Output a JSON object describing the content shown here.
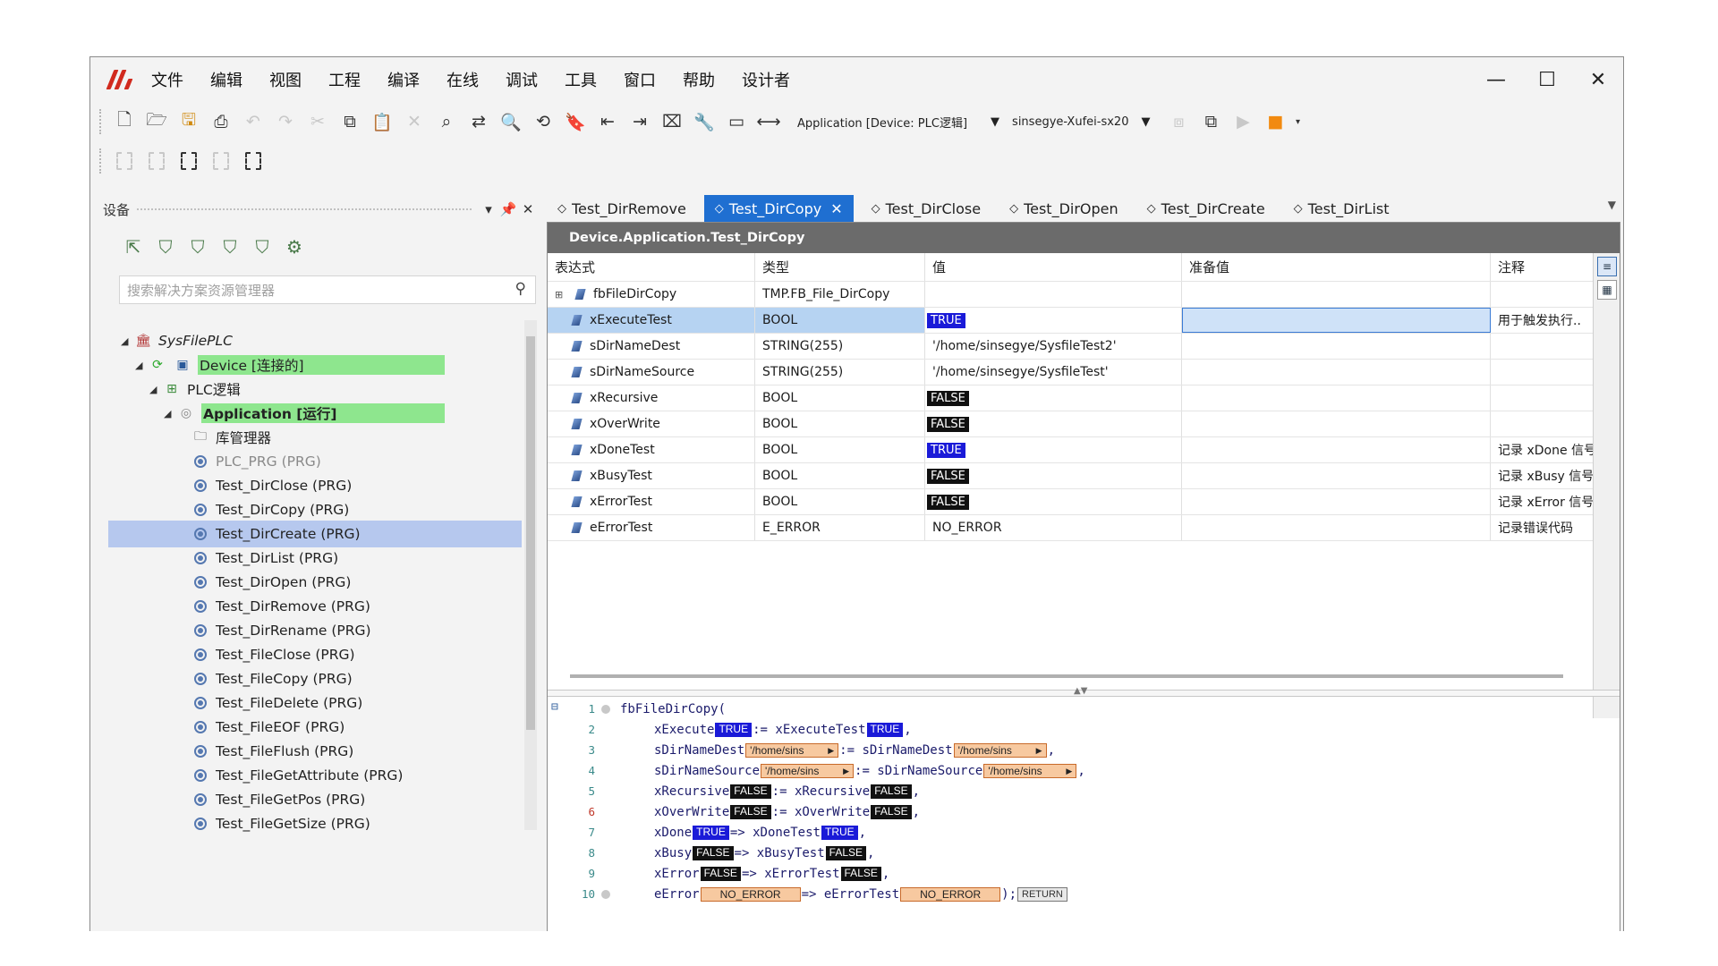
{
  "menu": [
    "文件",
    "编辑",
    "视图",
    "工程",
    "编译",
    "在线",
    "调试",
    "工具",
    "窗口",
    "帮助",
    "设计者"
  ],
  "window_controls": {
    "minimize": "—",
    "maximize": "☐",
    "close": "✕"
  },
  "toolbar": {
    "app_combo": "Application [Device: PLC逻辑]",
    "device_combo": "sinsegye-Xufei-sx20"
  },
  "left_pane": {
    "title": "设备",
    "search_placeholder": "搜索解决方案资源管理器",
    "tree": [
      {
        "label": "SysFilePLC",
        "level": 0
      },
      {
        "label": "Device [连接的]",
        "level": 1
      },
      {
        "label": "PLC逻辑",
        "level": 2
      },
      {
        "label": "Application [运行]",
        "level": 3
      },
      {
        "label": "库管理器",
        "level": 4
      },
      {
        "label": "PLC_PRG (PRG)",
        "level": 4
      },
      {
        "label": "Test_DirClose (PRG)",
        "level": 4
      },
      {
        "label": "Test_DirCopy (PRG)",
        "level": 4
      },
      {
        "label": "Test_DirCreate (PRG)",
        "level": 4
      },
      {
        "label": "Test_DirList (PRG)",
        "level": 4
      },
      {
        "label": "Test_DirOpen (PRG)",
        "level": 4
      },
      {
        "label": "Test_DirRemove (PRG)",
        "level": 4
      },
      {
        "label": "Test_DirRename (PRG)",
        "level": 4
      },
      {
        "label": "Test_FileClose (PRG)",
        "level": 4
      },
      {
        "label": "Test_FileCopy (PRG)",
        "level": 4
      },
      {
        "label": "Test_FileDelete (PRG)",
        "level": 4
      },
      {
        "label": "Test_FileEOF (PRG)",
        "level": 4
      },
      {
        "label": "Test_FileFlush (PRG)",
        "level": 4
      },
      {
        "label": "Test_FileGetAttribute (PRG)",
        "level": 4
      },
      {
        "label": "Test_FileGetPos (PRG)",
        "level": 4
      },
      {
        "label": "Test_FileGetSize (PRG)",
        "level": 4
      }
    ]
  },
  "tabs": [
    "Test_DirRemove",
    "Test_DirCopy",
    "Test_DirClose",
    "Test_DirOpen",
    "Test_DirCreate",
    "Test_DirList"
  ],
  "active_tab": "Test_DirCopy",
  "editor": {
    "title": "Device.Application.Test_DirCopy",
    "columns": {
      "expr": "表达式",
      "type": "类型",
      "value": "值",
      "prepared": "准备值",
      "comment": "注释"
    },
    "rows": [
      {
        "expr": "fbFileDirCopy",
        "type": "TMP.FB_File_DirCopy",
        "value": "",
        "comment": ""
      },
      {
        "expr": "xExecuteTest",
        "type": "BOOL",
        "value": "TRUE",
        "comment": "用于触发执行.."
      },
      {
        "expr": "sDirNameDest",
        "type": "STRING(255)",
        "value": "'/home/sinsegye/SysfileTest2'",
        "comment": ""
      },
      {
        "expr": "sDirNameSource",
        "type": "STRING(255)",
        "value": "'/home/sinsegye/SysfileTest'",
        "comment": ""
      },
      {
        "expr": "xRecursive",
        "type": "BOOL",
        "value": "FALSE",
        "comment": ""
      },
      {
        "expr": "xOverWrite",
        "type": "BOOL",
        "value": "FALSE",
        "comment": ""
      },
      {
        "expr": "xDoneTest",
        "type": "BOOL",
        "value": "TRUE",
        "comment": "记录 xDone 信号"
      },
      {
        "expr": "xBusyTest",
        "type": "BOOL",
        "value": "FALSE",
        "comment": "记录 xBusy 信号"
      },
      {
        "expr": "xErrorTest",
        "type": "BOOL",
        "value": "FALSE",
        "comment": "记录 xError 信号"
      },
      {
        "expr": "eErrorTest",
        "type": "E_ERROR",
        "value": "NO_ERROR",
        "comment": "记录错误代码"
      }
    ]
  },
  "code": {
    "l1": "fbFileDirCopy(",
    "l2a": "xExecute",
    "l2b": ":= xExecuteTest",
    "l3a": "sDirNameDest",
    "l3b": ":= sDirNameDest",
    "l4a": "sDirNameSource",
    "l4b": ":= sDirNameSource",
    "l5a": "xRecursive",
    "l5b": ":= xRecursive",
    "l6a": "xOverWrite",
    "l6b": ":= xOverWrite",
    "l7a": "xDone",
    "l7b": "=> xDoneTest",
    "l8a": "xBusy",
    "l8b": "=> xBusyTest",
    "l9a": "xError",
    "l9b": "=> xErrorTest",
    "l10a": "eError",
    "l10b": "=> eErrorTest",
    "v_true": "TRUE",
    "v_false": "FALSE",
    "v_str": "'/home/sins",
    "v_err": "NO_ERROR",
    "ret": "RETURN",
    "comma": ",",
    "close": ");"
  }
}
